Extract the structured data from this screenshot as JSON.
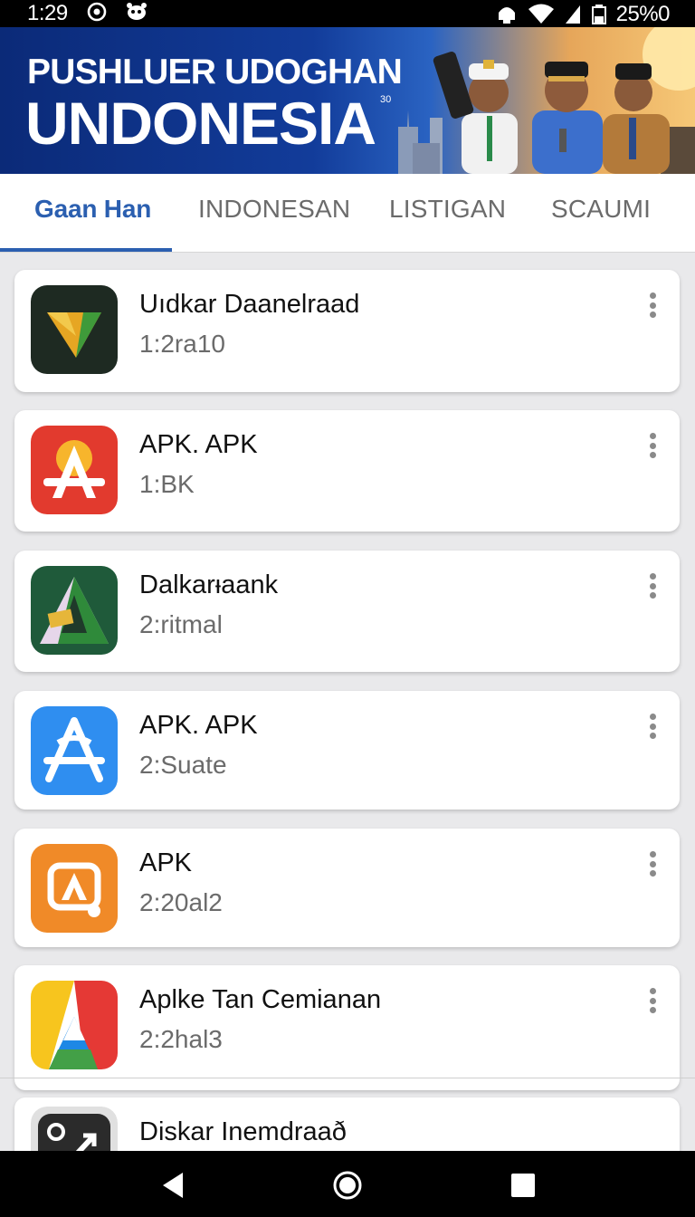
{
  "status_bar": {
    "time": "1:29",
    "battery_text": "25%0"
  },
  "banner": {
    "line1": "PUSHLUER UDOGHAN",
    "line2": "UNDONESIA",
    "superscript": "30"
  },
  "tabs": [
    {
      "label": "Gaan Han",
      "active": true
    },
    {
      "label": "INDONESAN",
      "active": false
    },
    {
      "label": "LISTIGAN",
      "active": false
    },
    {
      "label": "SCAUMI",
      "active": false
    }
  ],
  "apps": [
    {
      "name": "Uıdkar Daanelraad",
      "sub": "1:2ra10",
      "icon": "triangle-icon"
    },
    {
      "name": "APK. APK",
      "sub": "1:BK",
      "icon": "red-a-icon"
    },
    {
      "name": "Dalkarᵼaank",
      "sub": "2:ritmal",
      "icon": "green-a-icon"
    },
    {
      "name": "APK. APK",
      "sub": "2:Suate",
      "icon": "blue-a-icon"
    },
    {
      "name": "APK",
      "sub": "2:20al2",
      "icon": "orange-a-icon"
    },
    {
      "name": "Aplke Tan Cemianan",
      "sub": "2:2hal3",
      "icon": "multicolor-a-icon"
    },
    {
      "name": "Diskar Inemdraað",
      "sub": "",
      "icon": "dark-tool-icon"
    }
  ],
  "colors": {
    "accent": "#2b5fb0",
    "banner_dark": "#0b2a78",
    "status_bar": "#000000",
    "nav_bar": "#000000"
  }
}
